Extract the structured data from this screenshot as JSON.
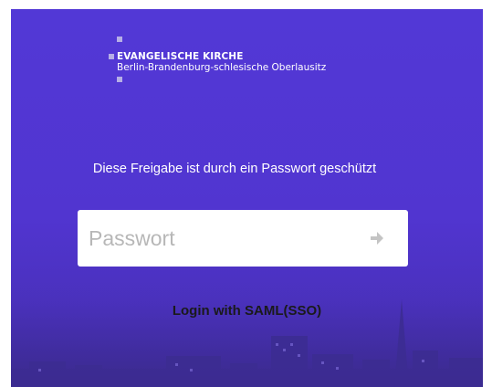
{
  "logo": {
    "title": "EVANGELISCHE KIRCHE",
    "subtitle": "Berlin-Brandenburg-schlesische Oberlausitz"
  },
  "share": {
    "message": "Diese Freigabe ist durch ein Passwort geschützt"
  },
  "password": {
    "placeholder": "Passwort",
    "value": ""
  },
  "login": {
    "saml_label": "Login with SAML(SSO)"
  },
  "colors": {
    "background": "#5238d6",
    "text": "#ffffff",
    "link": "#1a1a1a",
    "icon": "#c4c4c4"
  },
  "icons": {
    "submit": "arrow-right-icon"
  }
}
